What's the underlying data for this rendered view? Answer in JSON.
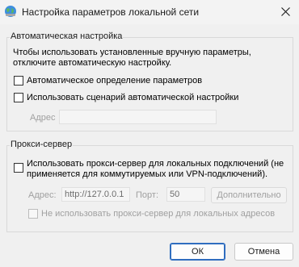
{
  "window": {
    "title": "Настройка параметров локальной сети",
    "icon": "network-globe-icon"
  },
  "auto_config": {
    "legend": "Автоматическая настройка",
    "description_line1": "Чтобы использовать установленные вручную параметры,",
    "description_line2": "отключите автоматическую настройку.",
    "auto_detect_label": "Автоматическое определение параметров",
    "auto_detect_checked": false,
    "use_script_label": "Использовать сценарий автоматической настройки",
    "use_script_checked": false,
    "address_label": "Адрес",
    "address_value": ""
  },
  "proxy": {
    "legend": "Прокси-сервер",
    "use_proxy_label_line1": "Использовать прокси-сервер для локальных подключений (не",
    "use_proxy_label_line2": "применяется для коммутируемых или VPN-подключений).",
    "use_proxy_checked": false,
    "address_label": "Адрес:",
    "address_value": "http://127.0.0.1",
    "port_label": "Порт:",
    "port_value": "50",
    "advanced_button": "Дополнительно",
    "bypass_local_label": "Не использовать прокси-сервер для локальных адресов",
    "bypass_local_checked": false
  },
  "footer": {
    "ok_button": "ОК",
    "cancel_button": "Отмена"
  },
  "colors": {
    "accent": "#2f6dbf",
    "background": "#f0f0f0"
  }
}
